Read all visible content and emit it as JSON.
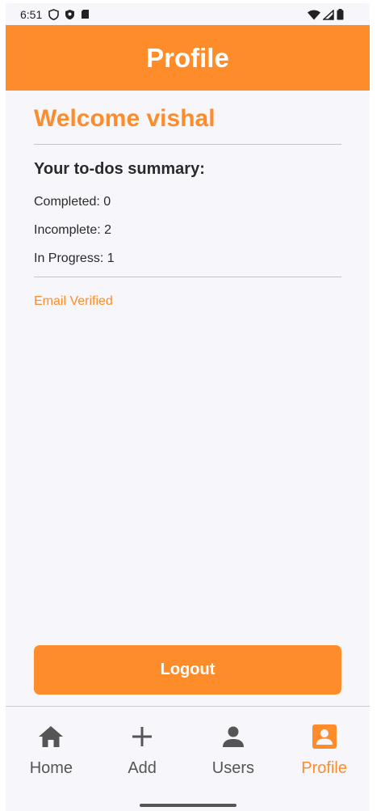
{
  "status_bar": {
    "time": "6:51",
    "left_icons": [
      "shield-outline-icon",
      "shield-filled-icon",
      "sim-card-icon"
    ],
    "right_icons": [
      "wifi-icon",
      "signal-icon",
      "battery-icon"
    ]
  },
  "app_bar": {
    "title": "Profile",
    "color": "#fe8c2a"
  },
  "profile": {
    "welcome": "Welcome vishal",
    "summary_title": "Your to-dos summary:",
    "completed": "Completed: 0",
    "incomplete": "Incomplete: 2",
    "in_progress": "In Progress: 1",
    "email_status": "Email Verified"
  },
  "logout": {
    "label": "Logout"
  },
  "bottom_nav": {
    "items": [
      {
        "label": "Home",
        "icon": "home-icon",
        "active": false
      },
      {
        "label": "Add",
        "icon": "plus-icon",
        "active": false
      },
      {
        "label": "Users",
        "icon": "person-icon",
        "active": false
      },
      {
        "label": "Profile",
        "icon": "account-box-icon",
        "active": true
      }
    ]
  },
  "colors": {
    "accent": "#fe8c2a",
    "background": "#f7f6fb",
    "text": "#2a2a2a",
    "inactive_nav": "#555555"
  }
}
